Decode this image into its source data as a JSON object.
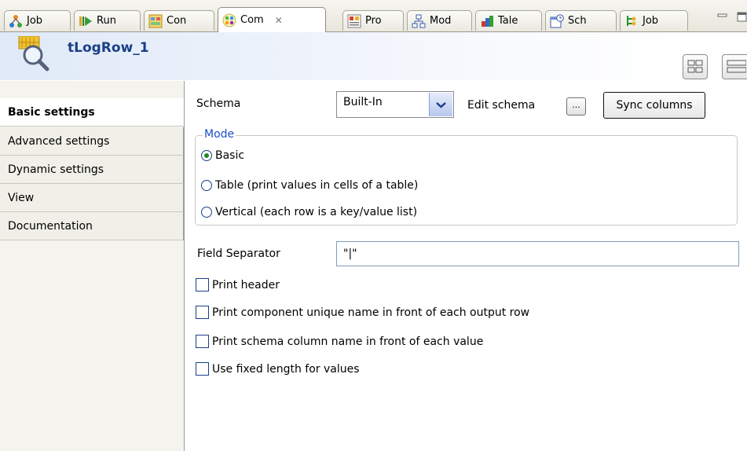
{
  "tabs": [
    {
      "label": "Job",
      "icon": "job-icon"
    },
    {
      "label": "Run",
      "icon": "run-icon"
    },
    {
      "label": "Con",
      "icon": "contexts-icon"
    },
    {
      "label": "Com",
      "icon": "component-icon",
      "active": true,
      "close_glyph": "✕"
    },
    {
      "label": "Pro",
      "icon": "problems-icon"
    },
    {
      "label": "Mod",
      "icon": "modules-icon"
    },
    {
      "label": "Tale",
      "icon": "talend-icon"
    },
    {
      "label": "Sch",
      "icon": "scheduler-icon"
    },
    {
      "label": "Job",
      "icon": "job-hierarchy-icon"
    }
  ],
  "header": {
    "title": "tLogRow_1",
    "logo_icon": "tlogrow-magnifier-icon"
  },
  "nav": [
    {
      "label": "Basic settings",
      "active": true
    },
    {
      "label": "Advanced settings"
    },
    {
      "label": "Dynamic settings"
    },
    {
      "label": "View"
    },
    {
      "label": "Documentation"
    }
  ],
  "schema": {
    "label": "Schema",
    "value": "Built-In",
    "edit_label": "Edit schema",
    "edit_button": "...",
    "sync_button": "Sync columns"
  },
  "mode": {
    "legend": "Mode",
    "options": [
      {
        "label": "Basic",
        "selected": true
      },
      {
        "label": "Table (print values in cells of a table)",
        "selected": false
      },
      {
        "label": "Vertical (each row is a key/value list)",
        "selected": false
      }
    ]
  },
  "separator": {
    "label": "Field Separator",
    "value": "\"|\""
  },
  "checks": [
    {
      "label": "Print header",
      "checked": false
    },
    {
      "label": "Print component unique name in front of each output row",
      "checked": false
    },
    {
      "label": "Print schema column name in front of each value",
      "checked": false
    },
    {
      "label": "Use fixed length for values",
      "checked": false
    }
  ],
  "colors": {
    "accent": "#1b4fc4",
    "title": "#1b3f87",
    "radio_on": "#1f8b1f"
  }
}
